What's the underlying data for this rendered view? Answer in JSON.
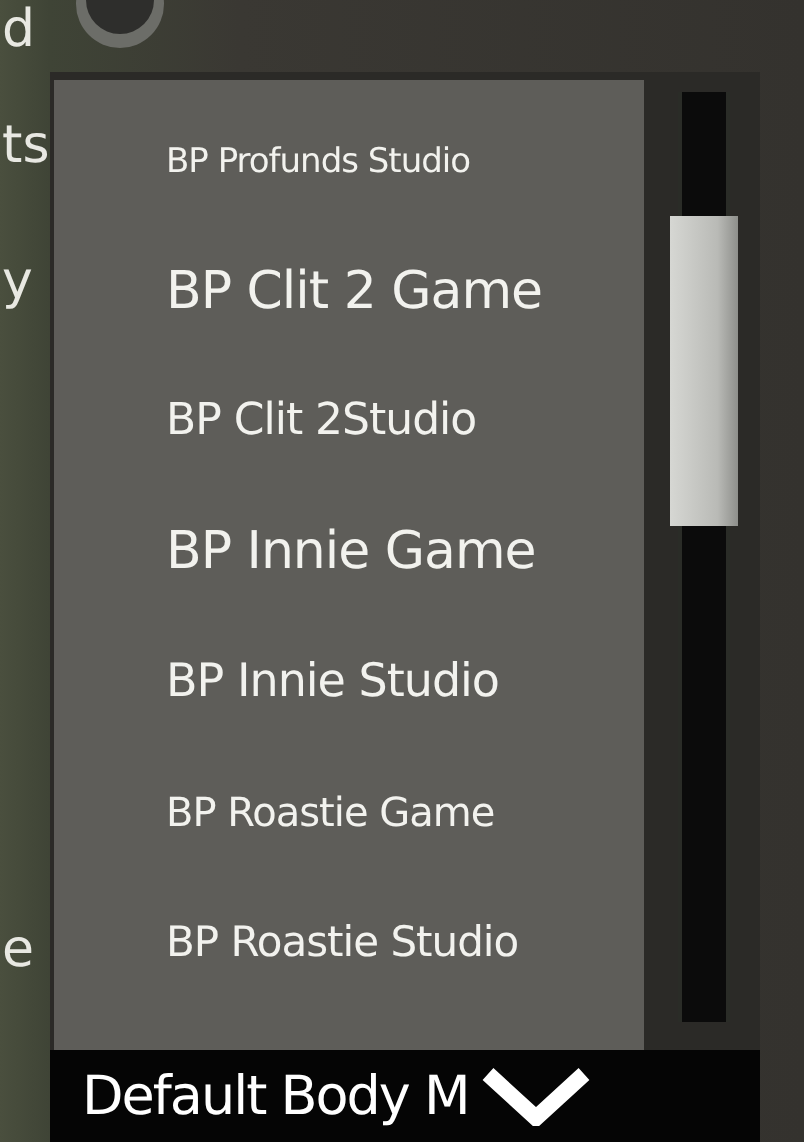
{
  "background_labels": [
    {
      "text": "d"
    },
    {
      "text": "ts"
    },
    {
      "text": "y"
    },
    {
      "text": "e"
    }
  ],
  "dropdown": {
    "options": [
      {
        "label": "BP Profunds Studio"
      },
      {
        "label": "BP Clit 2 Game"
      },
      {
        "label": "BP Clit 2Studio"
      },
      {
        "label": "BP Innie Game"
      },
      {
        "label": "BP Innie Studio"
      },
      {
        "label": "BP Roastie Game"
      },
      {
        "label": "BP Roastie  Studio"
      }
    ],
    "value": "Default Body M"
  }
}
